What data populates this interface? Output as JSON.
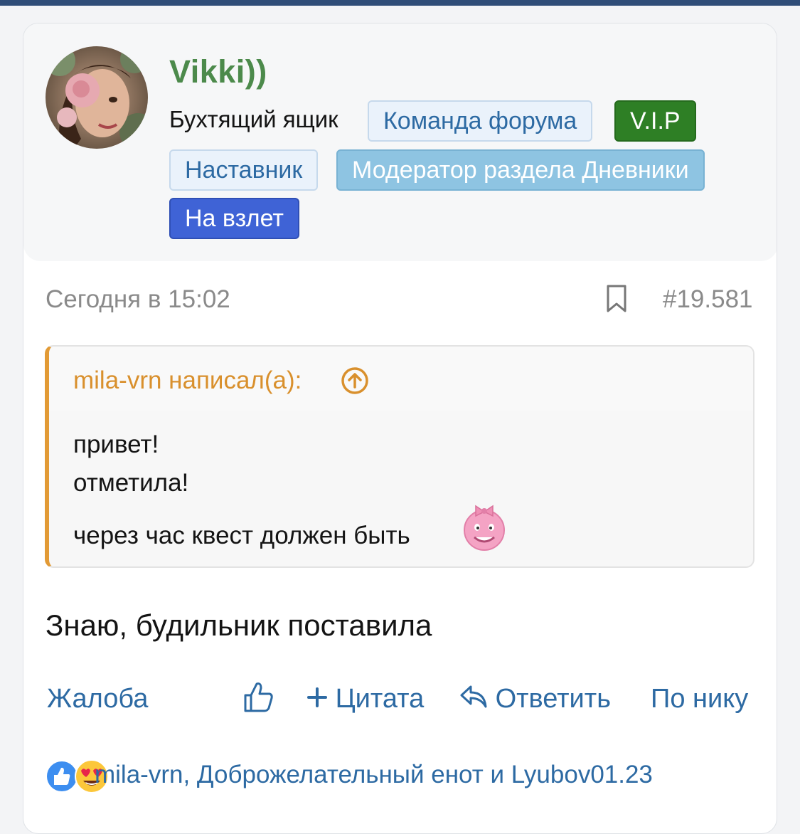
{
  "user": {
    "name": "Vikki))",
    "title": "Бухтящий ящик",
    "badges": {
      "team": "Команда форума",
      "vip": "V.I.P",
      "mentor": "Наставник",
      "moderator": "Модератор раздела Дневники",
      "takeoff": "На взлет"
    }
  },
  "post": {
    "date": "Сегодня в 15:02",
    "number": "#19.581",
    "message": "Знаю, будильник поставила"
  },
  "quote": {
    "author": "mila-vrn написал(а):",
    "lines": [
      "привет!",
      "отметила!",
      "через час квест должен быть"
    ]
  },
  "actions": {
    "report": "Жалоба",
    "quote": "Цитата",
    "reply": "Ответить",
    "by_nick": "По нику"
  },
  "reactions": {
    "text": "mila-vrn, Доброжелательный енот и Lyubov01.23",
    "icons": [
      "like-icon",
      "heart-eyes-icon"
    ]
  },
  "colors": {
    "username": "#4c8a4b",
    "link": "#2d6aa3",
    "quote_accent": "#e29a35",
    "vip": "#2e7f25",
    "moderator": "#8ec4e2",
    "takeoff": "#3f63d6"
  }
}
